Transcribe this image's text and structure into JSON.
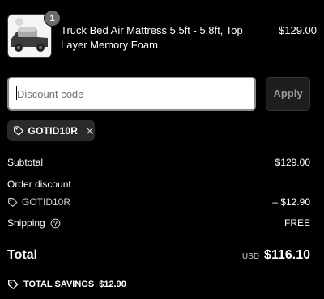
{
  "cart": {
    "item": {
      "name": "Truck Bed Air Mattress 5.5ft - 5.8ft, Top Layer Memory Foam",
      "price": "$129.00",
      "quantity": "1"
    }
  },
  "discount": {
    "placeholder": "Discount code",
    "value": "",
    "apply_label": "Apply",
    "applied_code": "GOTID10R"
  },
  "summary": {
    "subtotal_label": "Subtotal",
    "subtotal_value": "$129.00",
    "order_discount_label": "Order discount",
    "order_discount_code": "GOTID10R",
    "order_discount_value": "– $12.90",
    "shipping_label": "Shipping",
    "shipping_value": "FREE",
    "total_label": "Total",
    "currency": "USD",
    "total_value": "$116.10",
    "savings_label": "TOTAL SAVINGS",
    "savings_value": "$12.90"
  },
  "icons": {
    "tag": "tag-icon",
    "remove": "close-icon",
    "help": "help-circle-icon",
    "savings": "tag-icon"
  }
}
